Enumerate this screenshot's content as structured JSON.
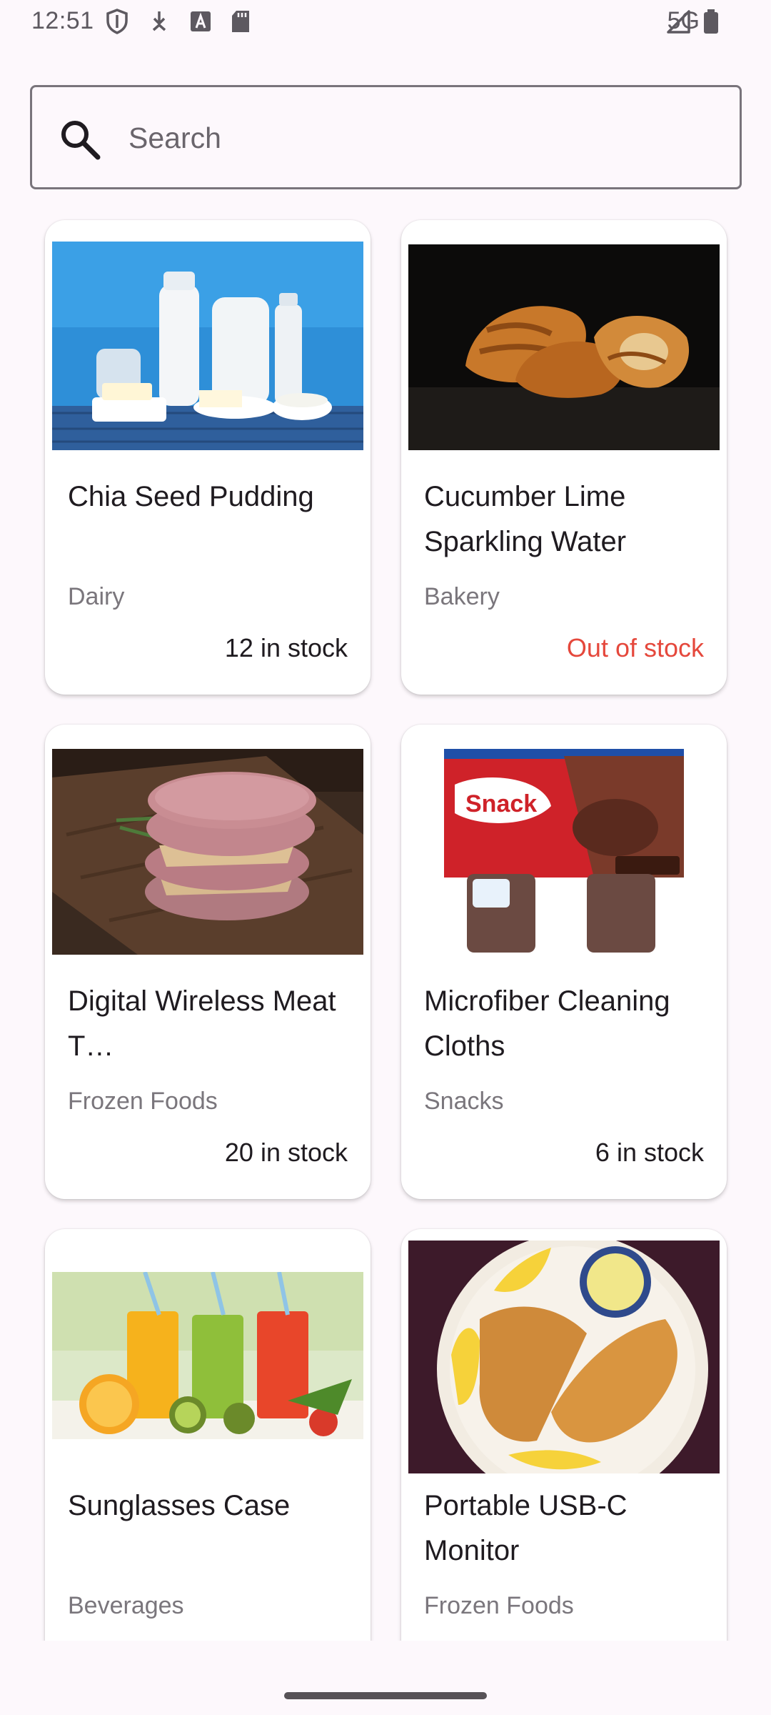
{
  "status_bar": {
    "time": "12:51",
    "network": "5G",
    "icons": [
      "shield-icon",
      "download-icon",
      "a-icon",
      "sd-card-icon",
      "signal-icon",
      "battery-icon"
    ]
  },
  "search": {
    "placeholder": "Search",
    "value": ""
  },
  "products": [
    {
      "title": "Chia Seed Pudding",
      "category": "Dairy",
      "stock": "12 in stock",
      "in_stock": true,
      "image": "dairy-products"
    },
    {
      "title": "Cucumber Lime Sparkling Water",
      "category": "Bakery",
      "stock": "Out of stock",
      "in_stock": false,
      "image": "croissants"
    },
    {
      "title": "Digital Wireless Meat T…",
      "category": "Frozen Foods",
      "stock": "20 in stock",
      "in_stock": true,
      "image": "burger-patties"
    },
    {
      "title": "Microfiber Cleaning Cloths",
      "category": "Snacks",
      "stock": "6 in stock",
      "in_stock": true,
      "image": "snack-pack-pudding"
    },
    {
      "title": "Sunglasses Case",
      "category": "Beverages",
      "stock": "",
      "in_stock": true,
      "image": "juice-glasses"
    },
    {
      "title": "Portable USB-C Monitor",
      "category": "Frozen Foods",
      "stock": "",
      "in_stock": true,
      "image": "fish-fillets"
    }
  ],
  "colors": {
    "background": "#fdf8fc",
    "out_of_stock": "#e5483c",
    "category_text": "#7a767c"
  }
}
